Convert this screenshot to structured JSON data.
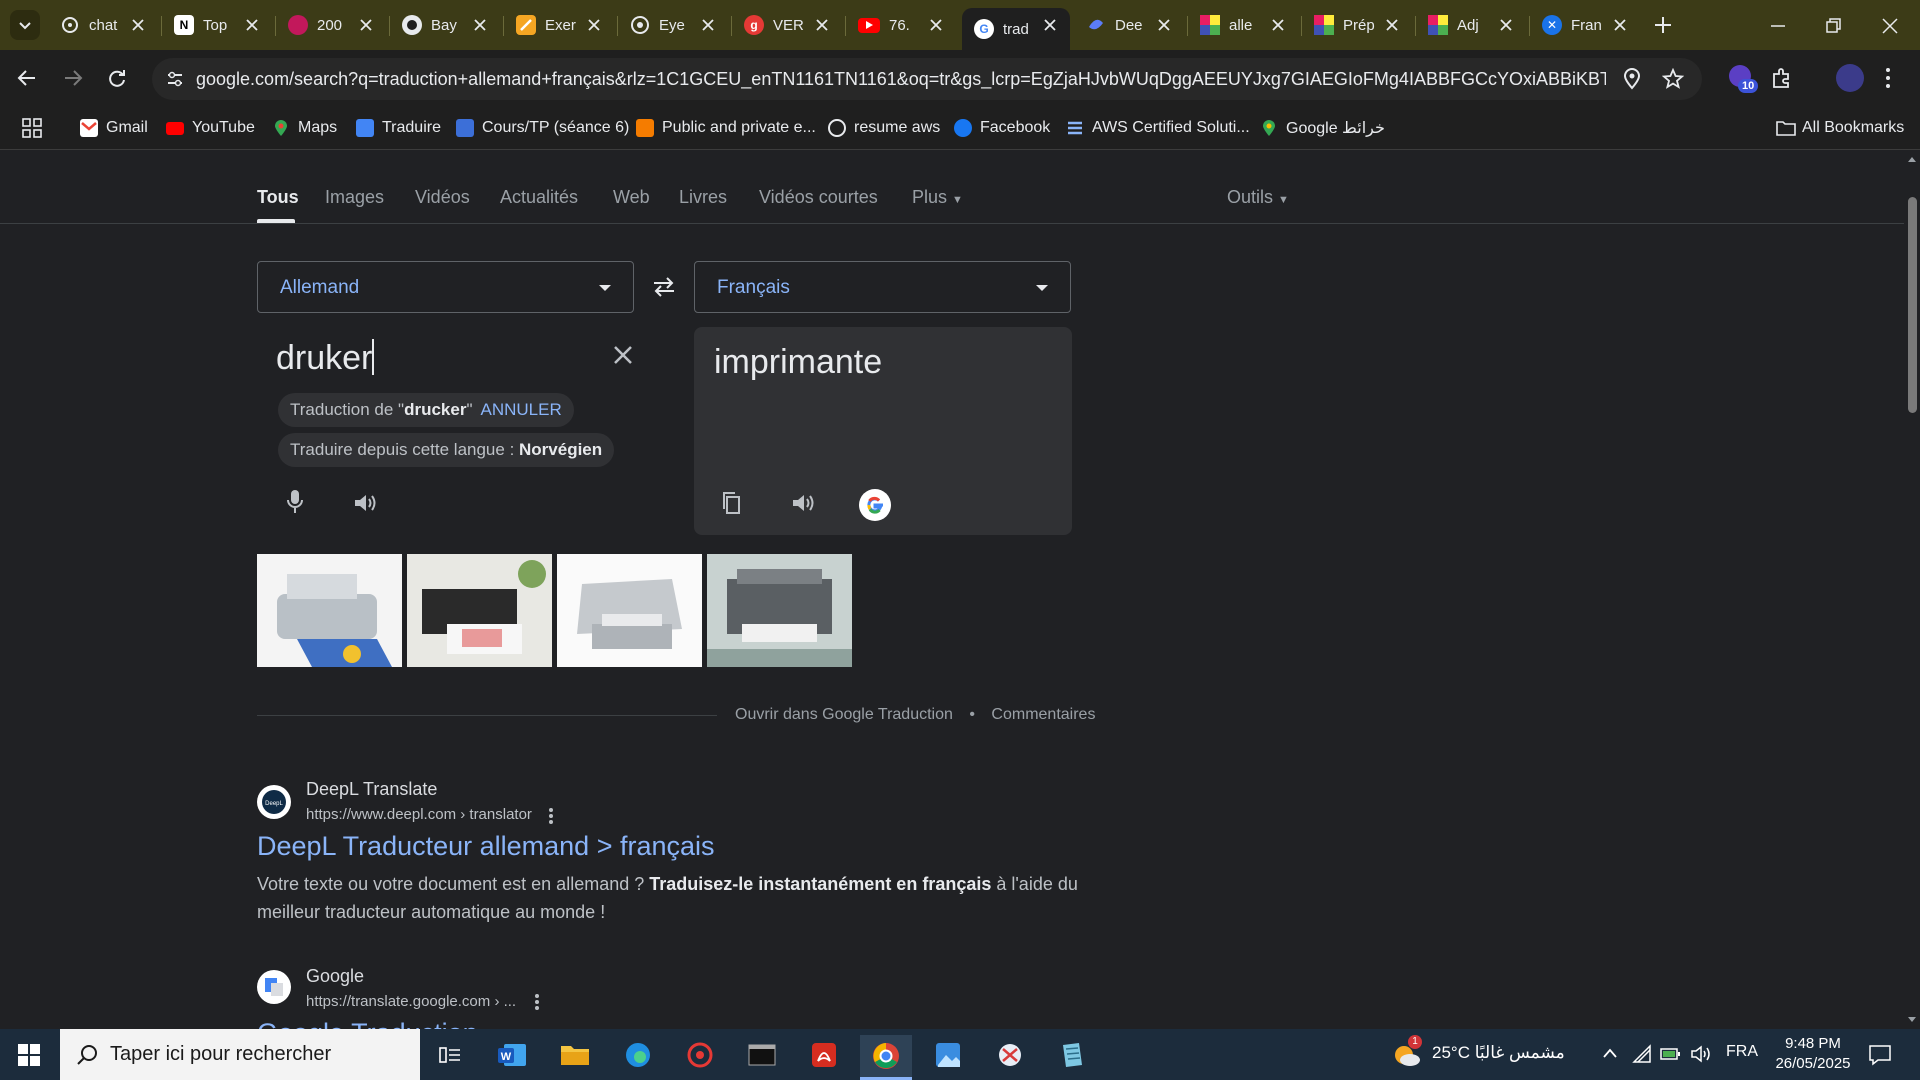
{
  "browser": {
    "tabs": [
      {
        "title": "chat",
        "icon": "chatgpt-icon"
      },
      {
        "title": "Top",
        "icon": "notion-icon"
      },
      {
        "title": "200",
        "icon": "game-icon"
      },
      {
        "title": "Bay",
        "icon": "github-icon"
      },
      {
        "title": "Exer",
        "icon": "pencil-icon"
      },
      {
        "title": "Eye",
        "icon": "eye-icon"
      },
      {
        "title": "VER",
        "icon": "grammarly-icon"
      },
      {
        "title": "76.",
        "icon": "youtube-icon"
      },
      {
        "title": "trad",
        "icon": "google-icon",
        "active": true
      },
      {
        "title": "Dee",
        "icon": "deepl-icon"
      },
      {
        "title": "alle",
        "icon": "multicolor-icon"
      },
      {
        "title": "Prép",
        "icon": "multicolor-icon"
      },
      {
        "title": "Adj",
        "icon": "multicolor-icon"
      },
      {
        "title": "Fran",
        "icon": "translate-icon"
      }
    ],
    "url": "google.com/search?q=traduction+allemand+français&rlz=1C1GCEU_enTN1161TN1161&oq=tr&gs_lcrp=EgZjaHJvbWUqDggAEEUYJxg7GIAEGIoFMg4IABBFGCcYOxiABBiKBTIGCAEQ...",
    "extension_badge": "10",
    "bookmarks": [
      "Gmail",
      "YouTube",
      "Maps",
      "Traduire",
      "Cours/TP (séance 6)",
      "Public and private e...",
      "resume aws",
      "Facebook",
      "AWS Certified Soluti...",
      "Google خرائط"
    ],
    "all_bookmarks": "All Bookmarks"
  },
  "search": {
    "tabs": [
      "Tous",
      "Images",
      "Vidéos",
      "Actualités",
      "Web",
      "Livres",
      "Vidéos courtes",
      "Plus"
    ],
    "tools": "Outils"
  },
  "translate": {
    "source_lang": "Allemand",
    "target_lang": "Français",
    "source_text": "druker",
    "target_text": "imprimante",
    "suggest_prefix": "Traduction de \"",
    "suggest_word": "drucker",
    "suggest_suffix": "\"",
    "suggest_cancel": "ANNULER",
    "detect_prefix": "Traduire depuis cette langue : ",
    "detect_lang": "Norvégien",
    "open_link": "Ouvrir dans Google Traduction",
    "separator": "•",
    "feedback": "Commentaires"
  },
  "results": [
    {
      "site": "DeepL Translate",
      "url": "https://www.deepl.com › translator",
      "title": "DeepL Traducteur allemand > français",
      "snippet_a": "Votre texte ou votre document est en allemand ? ",
      "snippet_b": "Traduisez-le instantanément en français",
      "snippet_c": " à l'aide du meilleur traducteur automatique au monde !"
    },
    {
      "site": "Google",
      "url": "https://translate.google.com › ...",
      "title": "Google Traduction"
    }
  ],
  "taskbar": {
    "search_placeholder": "Taper ici pour rechercher",
    "weather": "25°C  مشمس غالبًا",
    "weather_badge": "1",
    "language": "FRA",
    "time": "9:48 PM",
    "date": "26/05/2025"
  }
}
